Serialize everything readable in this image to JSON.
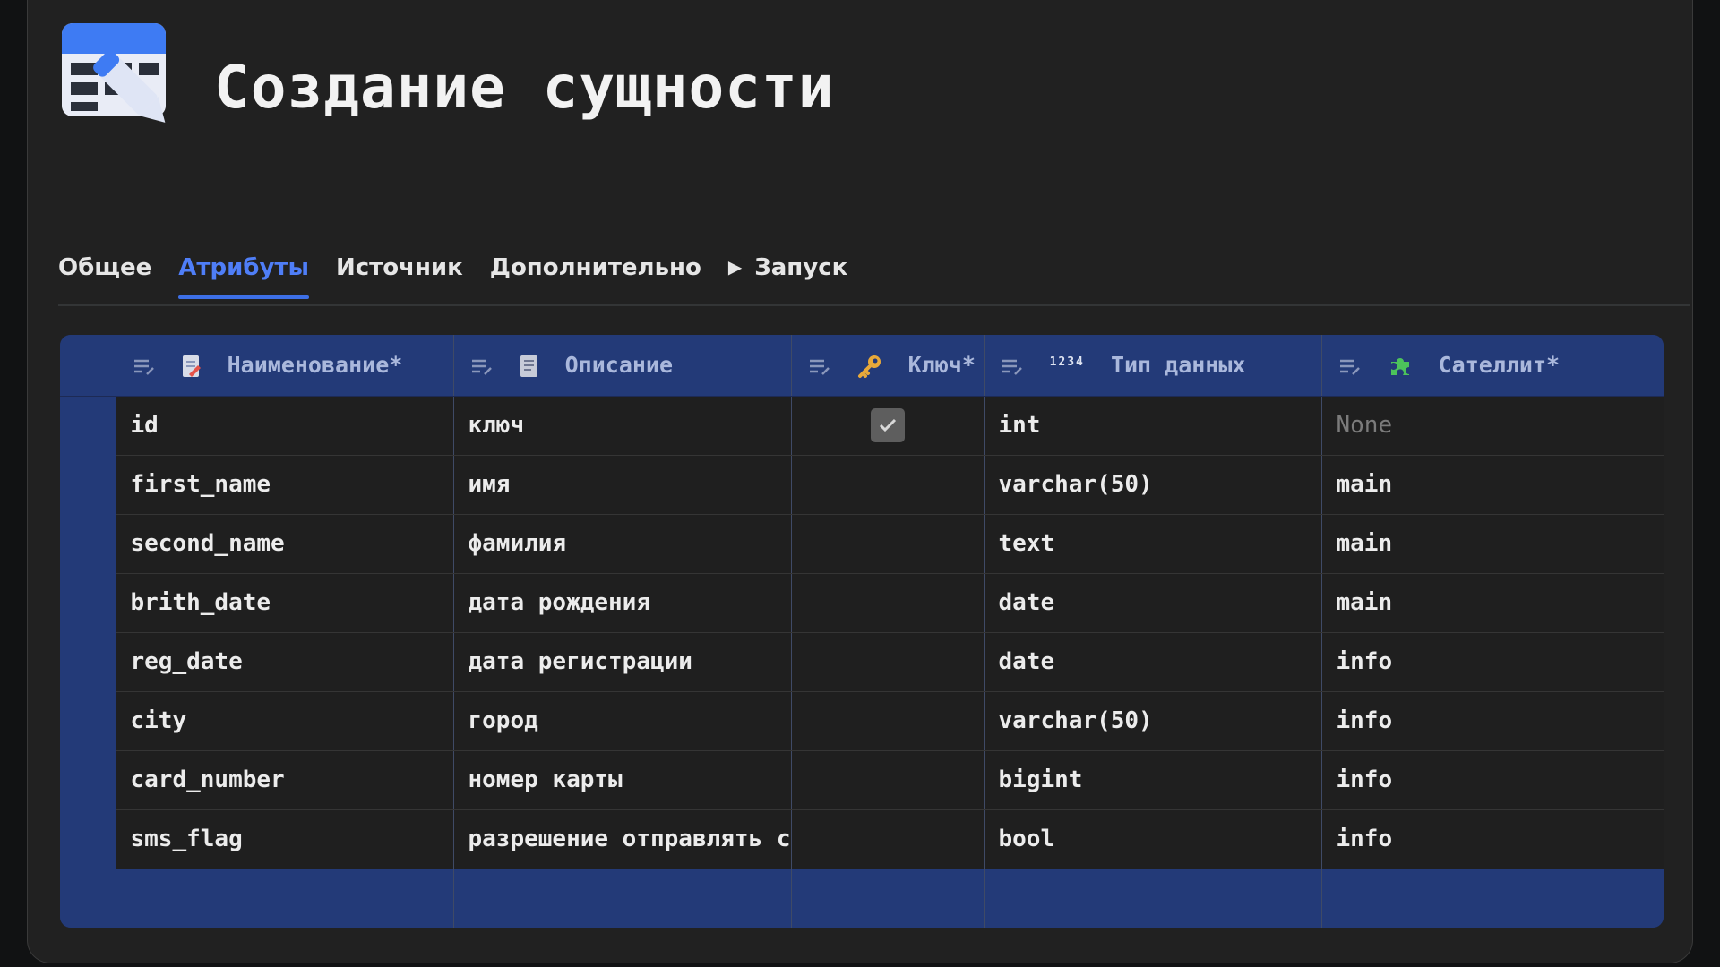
{
  "header": {
    "title": "Создание сущности"
  },
  "tabs": [
    {
      "label": "Общее"
    },
    {
      "label": "Атрибуты",
      "active": true
    },
    {
      "label": "Источник"
    },
    {
      "label": "Дополнительно"
    },
    {
      "label": "Запуск",
      "icon": "play-icon"
    }
  ],
  "table": {
    "columns": [
      {
        "label": "Наименование*",
        "icon": "document-edit-icon"
      },
      {
        "label": "Описание",
        "icon": "document-icon"
      },
      {
        "label": "Ключ*",
        "icon": "key-icon"
      },
      {
        "label": "Тип данных",
        "icon": "numbers-1234-icon",
        "prefix": "1234"
      },
      {
        "label": "Сателлит*",
        "icon": "puzzle-icon"
      }
    ],
    "rows": [
      {
        "name": "id",
        "description": "ключ",
        "key": true,
        "type": "int",
        "satellite": "None"
      },
      {
        "name": "first_name",
        "description": "имя",
        "key": false,
        "type": "varchar(50)",
        "satellite": "main"
      },
      {
        "name": "second_name",
        "description": "фамилия",
        "key": false,
        "type": "text",
        "satellite": "main"
      },
      {
        "name": "brith_date",
        "description": "дата рождения",
        "key": false,
        "type": "date",
        "satellite": "main"
      },
      {
        "name": "reg_date",
        "description": "дата регистрации",
        "key": false,
        "type": "date",
        "satellite": "info"
      },
      {
        "name": "city",
        "description": "город",
        "key": false,
        "type": "varchar(50)",
        "satellite": "info"
      },
      {
        "name": "card_number",
        "description": "номер карты",
        "key": false,
        "type": "bigint",
        "satellite": "info"
      },
      {
        "name": "sms_flag",
        "description": "разрешение отправлять с",
        "key": false,
        "type": "bool",
        "satellite": "info"
      }
    ]
  },
  "colors": {
    "accent": "#4f7ef7",
    "grid_header": "#233a78",
    "background": "#212121"
  }
}
